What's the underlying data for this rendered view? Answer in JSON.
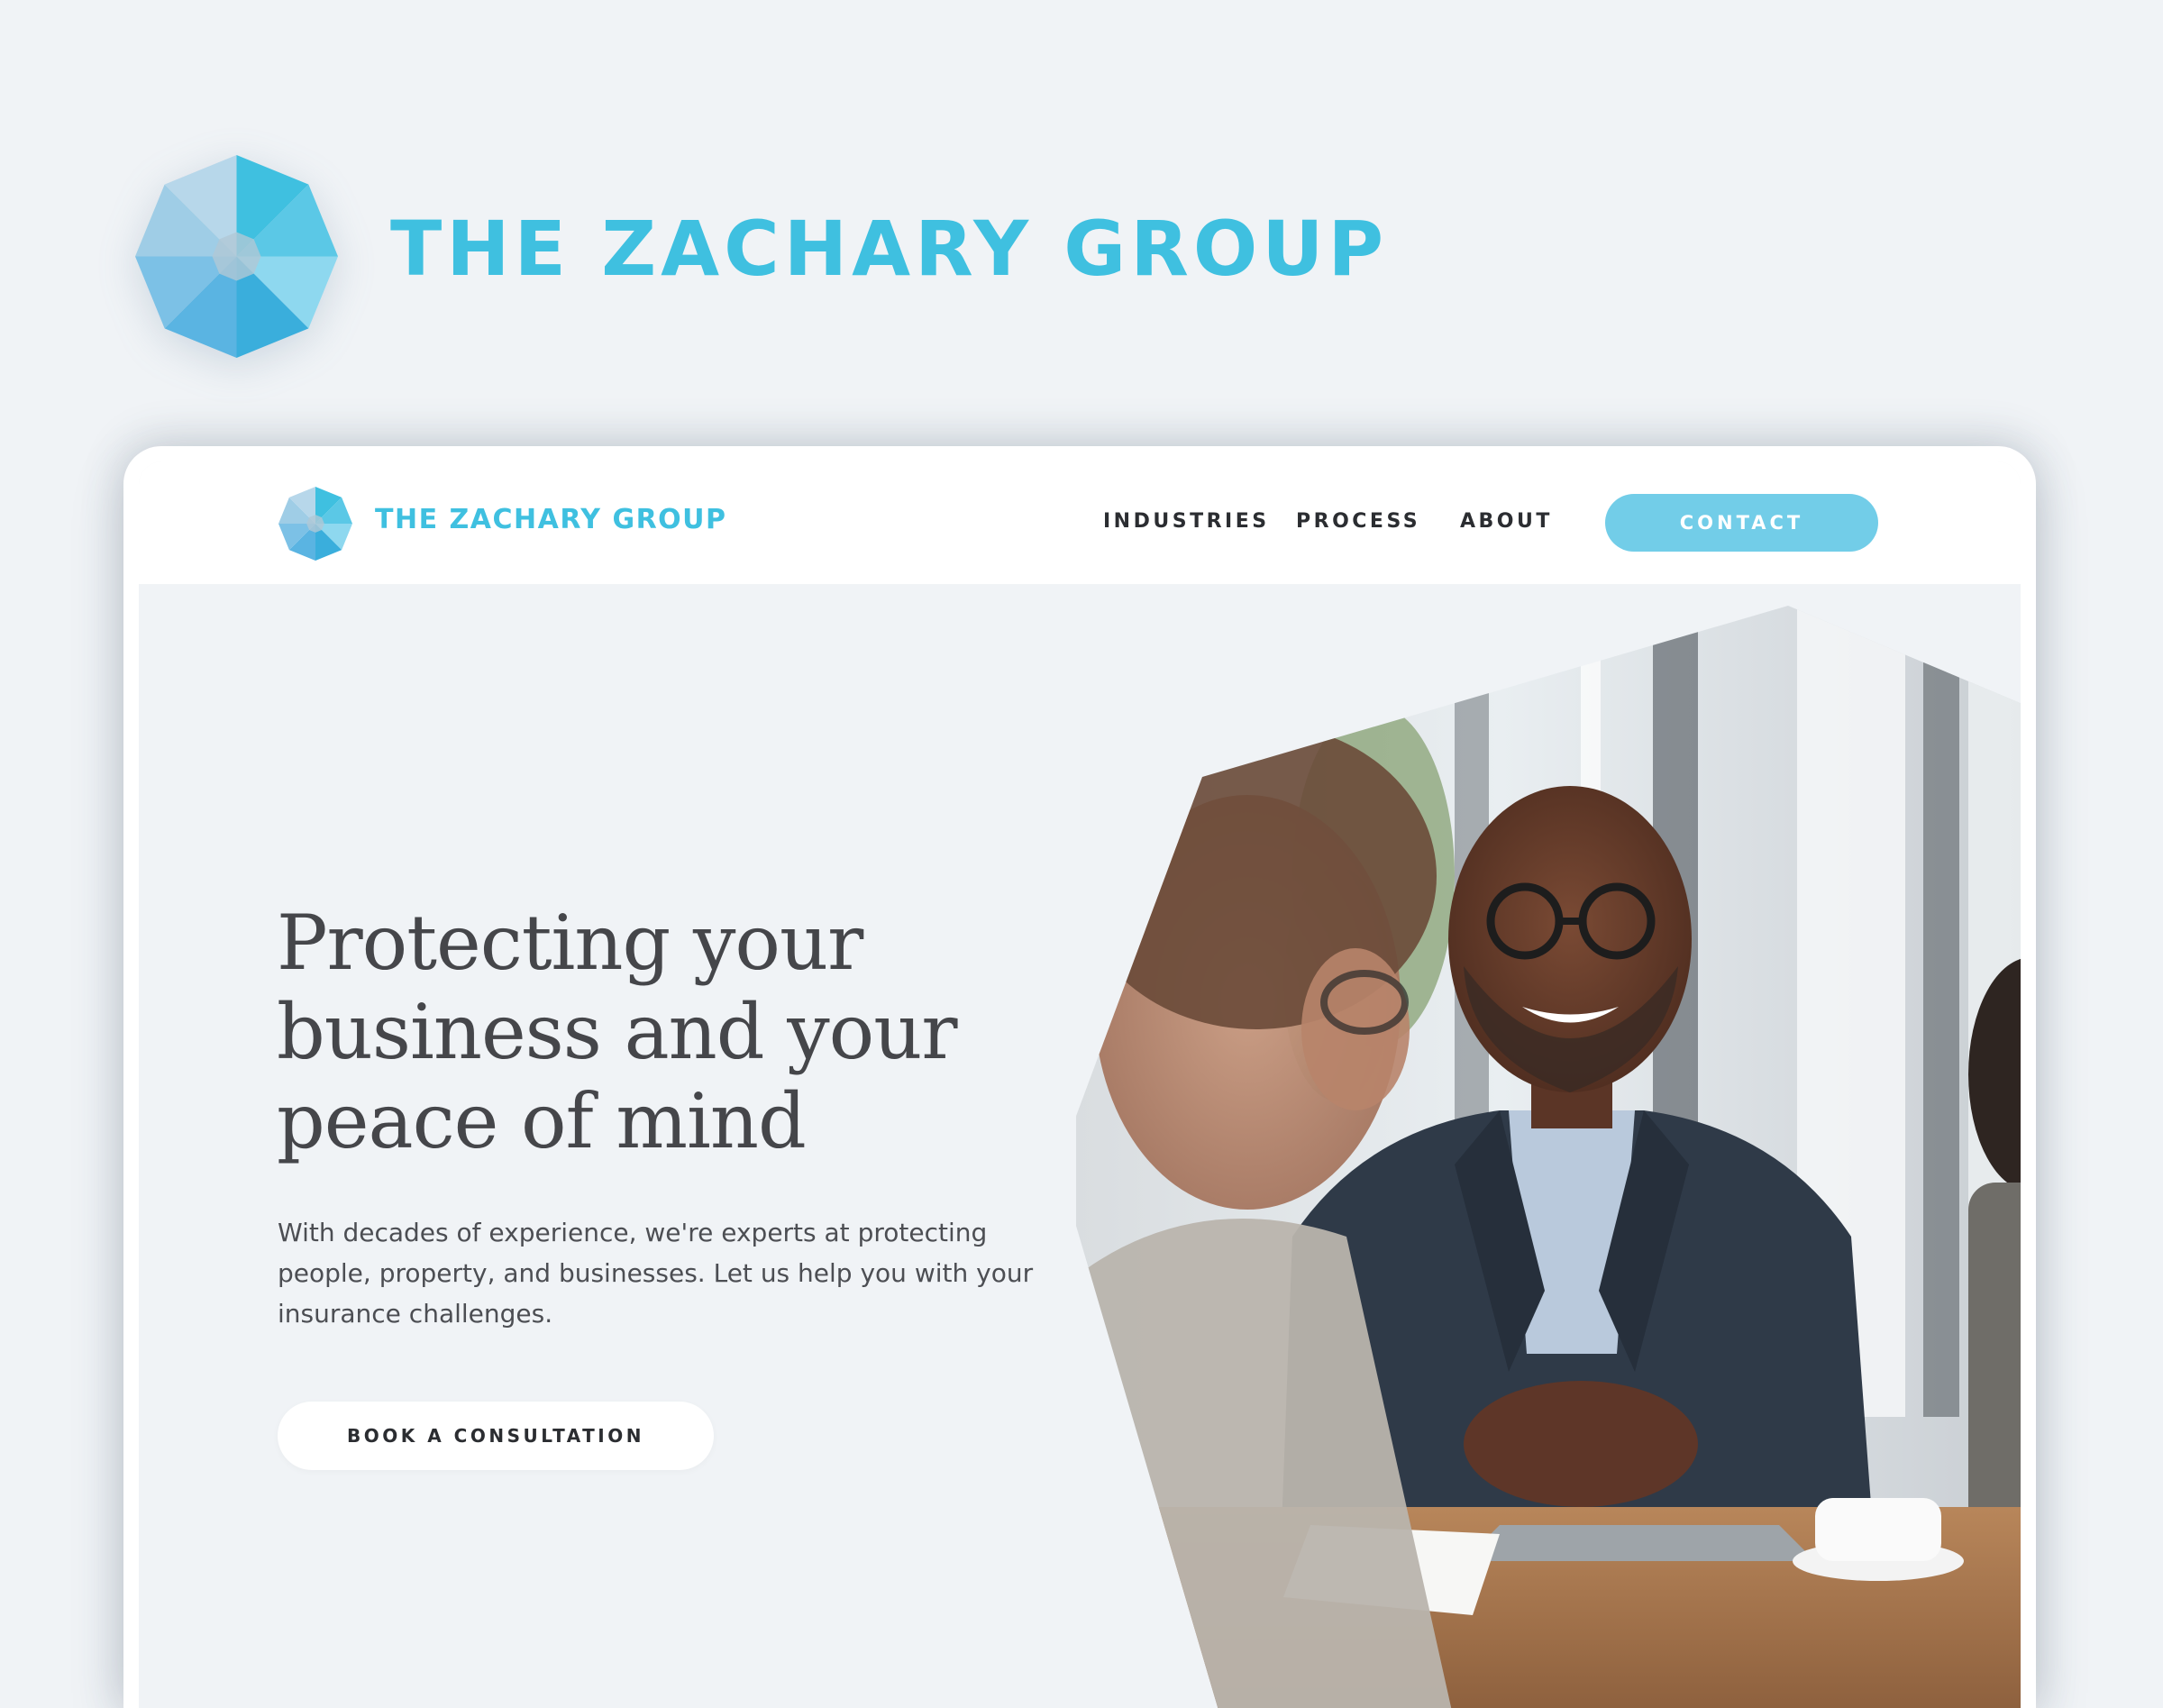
{
  "brand": {
    "name": "THE ZACHARY GROUP",
    "logo_icon": "octagon-logo-icon",
    "colors": {
      "primary": "#3fc0e0",
      "button": "#72cde8",
      "background": "#f0f3f6",
      "text_dark": "#2b2d31",
      "heading": "#45464a"
    }
  },
  "nav": {
    "brand": "THE ZACHARY GROUP",
    "links": [
      "INDUSTRIES",
      "PROCESS",
      "ABOUT"
    ],
    "contact_label": "CONTACT"
  },
  "hero": {
    "title_lines": [
      "Protecting your",
      "business and your",
      "peace of mind"
    ],
    "subtitle_lines": [
      "With decades of experience, we're experts at protecting",
      "people, property, and businesses. Let us help you with your",
      "insurance challenges."
    ],
    "cta_label": "BOOK A CONSULTATION",
    "image_icon": "business-meeting-photo"
  }
}
